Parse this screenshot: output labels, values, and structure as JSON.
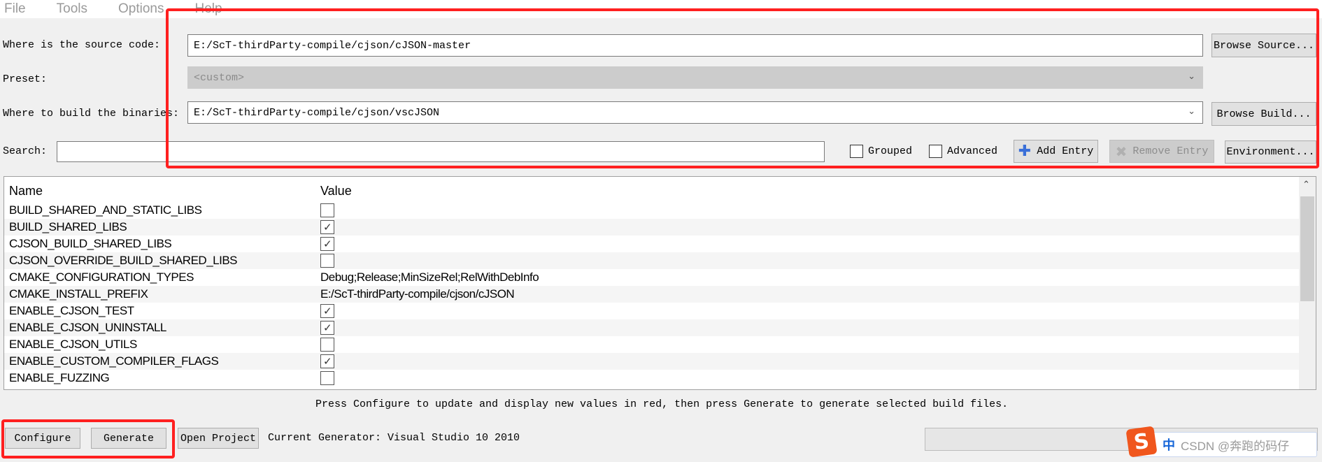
{
  "menu": [
    "File",
    "Tools",
    "Options",
    "Help"
  ],
  "source": {
    "label": "Where is the source code:",
    "value": "E:/ScT-thirdParty-compile/cjson/cJSON-master",
    "browse": "Browse Source..."
  },
  "preset": {
    "label": "Preset:",
    "value": "<custom>"
  },
  "build": {
    "label": "Where to build the binaries:",
    "value": "E:/ScT-thirdParty-compile/cjson/vscJSON",
    "browse": "Browse Build..."
  },
  "search": {
    "label": "Search:",
    "value": ""
  },
  "options": {
    "grouped": "Grouped",
    "grouped_checked": false,
    "advanced": "Advanced",
    "advanced_checked": false
  },
  "toolbar": {
    "add_entry": "Add Entry",
    "remove_entry": "Remove Entry",
    "environment": "Environment..."
  },
  "table": {
    "headers": [
      "Name",
      "Value"
    ],
    "rows": [
      {
        "name": "BUILD_SHARED_AND_STATIC_LIBS",
        "type": "bool",
        "checked": false
      },
      {
        "name": "BUILD_SHARED_LIBS",
        "type": "bool",
        "checked": true
      },
      {
        "name": "CJSON_BUILD_SHARED_LIBS",
        "type": "bool",
        "checked": true
      },
      {
        "name": "CJSON_OVERRIDE_BUILD_SHARED_LIBS",
        "type": "bool",
        "checked": false
      },
      {
        "name": "CMAKE_CONFIGURATION_TYPES",
        "type": "text",
        "value": "Debug;Release;MinSizeRel;RelWithDebInfo"
      },
      {
        "name": "CMAKE_INSTALL_PREFIX",
        "type": "text",
        "value": "E:/ScT-thirdParty-compile/cjson/cJSON"
      },
      {
        "name": "ENABLE_CJSON_TEST",
        "type": "bool",
        "checked": true
      },
      {
        "name": "ENABLE_CJSON_UNINSTALL",
        "type": "bool",
        "checked": true
      },
      {
        "name": "ENABLE_CJSON_UTILS",
        "type": "bool",
        "checked": false
      },
      {
        "name": "ENABLE_CUSTOM_COMPILER_FLAGS",
        "type": "bool",
        "checked": true
      },
      {
        "name": "ENABLE_FUZZING",
        "type": "bool",
        "checked": false
      }
    ]
  },
  "status": "Press Configure to update and display new values in red, then press Generate to generate selected build files.",
  "bottom": {
    "configure": "Configure",
    "generate": "Generate",
    "open_project": "Open Project",
    "generator": "Current Generator: Visual Studio 10 2010",
    "progress": 0
  },
  "watermark": "CSDN @奔跑的码仔",
  "ime": {
    "zh": "中"
  },
  "colors": {
    "highlight_box": "#ff2020",
    "add_icon": "#3a6fd8"
  }
}
